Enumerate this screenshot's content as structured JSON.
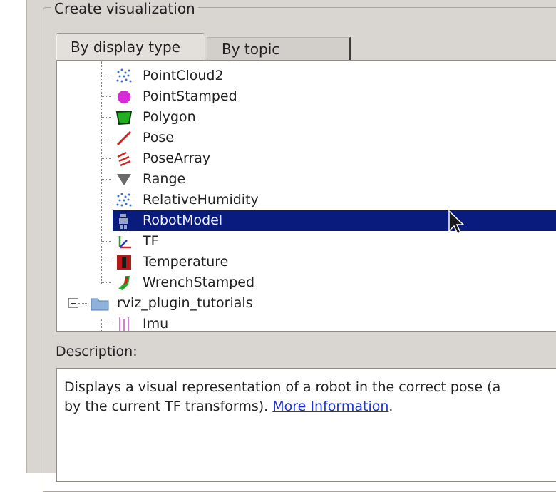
{
  "dialog": {
    "group_title": "Create visualization",
    "tabs": [
      {
        "label": "By display type",
        "active": true
      },
      {
        "label": "By topic",
        "active": false
      }
    ]
  },
  "tree": {
    "items": [
      {
        "label": "PointCloud2",
        "icon": "pointcloud-icon"
      },
      {
        "label": "PointStamped",
        "icon": "point-icon"
      },
      {
        "label": "Polygon",
        "icon": "polygon-icon"
      },
      {
        "label": "Pose",
        "icon": "pose-icon"
      },
      {
        "label": "PoseArray",
        "icon": "posearray-icon"
      },
      {
        "label": "Range",
        "icon": "range-icon"
      },
      {
        "label": "RelativeHumidity",
        "icon": "pointcloud-icon"
      },
      {
        "label": "RobotModel",
        "icon": "robot-icon",
        "selected": true
      },
      {
        "label": "TF",
        "icon": "tf-icon"
      },
      {
        "label": "Temperature",
        "icon": "temperature-icon"
      },
      {
        "label": "WrenchStamped",
        "icon": "wrench-icon"
      }
    ],
    "folder": {
      "label": "rviz_plugin_tutorials",
      "icon": "folder-icon",
      "expanded": true
    },
    "folder_children": [
      {
        "label": "Imu",
        "icon": "imu-icon"
      }
    ]
  },
  "description": {
    "label": "Description:",
    "text_line1": "Displays a visual representation of a robot in the correct pose (a",
    "text_line2_prefix": "by the current TF transforms).",
    "link": "More Information",
    "text_suffix": "."
  },
  "colors": {
    "selection": "#0a1b7e",
    "link": "#1a33d6",
    "dialog_bg": "#d9d6d2"
  }
}
